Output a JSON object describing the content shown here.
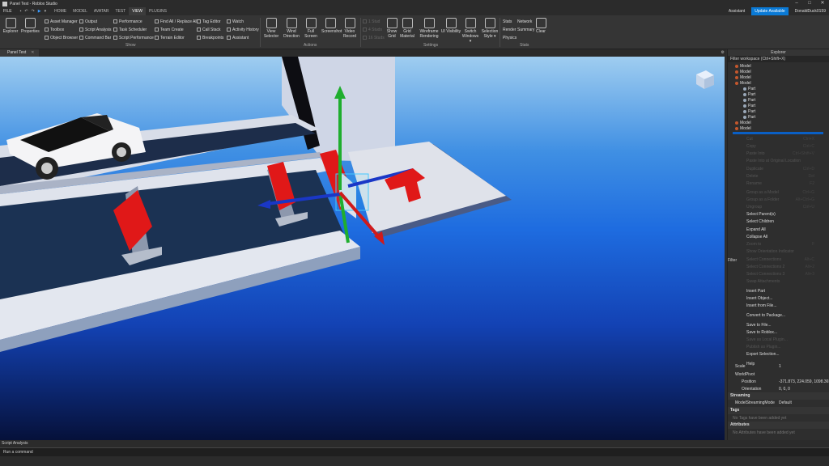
{
  "titlebar": {
    "title": "Panel Test - Roblox Studio",
    "min": "–",
    "max": "□",
    "close": "✕"
  },
  "menubar": {
    "file": "FILE",
    "tabs": [
      "HOME",
      "MODEL",
      "AVATAR",
      "TEST",
      "VIEW",
      "PLUGINS"
    ],
    "active_tab": "VIEW",
    "assistant": "Assistant",
    "update": "Update Available",
    "user": "DonaldDuck0159"
  },
  "ribbon": {
    "big_left": [
      "Explorer",
      "Properties"
    ],
    "show_col1": [
      "Asset Manager",
      "Toolbox",
      "Object Browser"
    ],
    "show_col2": [
      "Output",
      "Script Analysis",
      "Command Bar"
    ],
    "show_col3": [
      "Performance",
      "Task Scheduler",
      "Script Performance"
    ],
    "show_col4": [
      "Find All / Replace All",
      "Team Create",
      "Terrain Editor"
    ],
    "show_col5": [
      "Tag Editor",
      "Call Stack",
      "Breakpoints"
    ],
    "show_col6": [
      "Watch",
      "Activity History",
      "Assistant"
    ],
    "group_show": "Show",
    "actions": [
      {
        "l1": "View",
        "l2": "Selector"
      },
      {
        "l1": "Wind",
        "l2": "Direction"
      },
      {
        "l1": "Full",
        "l2": "Screen"
      },
      {
        "l1": "Screenshot",
        "l2": ""
      },
      {
        "l1": "Video",
        "l2": "Record"
      }
    ],
    "group_actions": "Actions",
    "studs": [
      "1 Stud",
      "4 Studs",
      "16 Studs"
    ],
    "settings": [
      {
        "l1": "Show",
        "l2": "Grid"
      },
      {
        "l1": "Grid",
        "l2": "Material"
      },
      {
        "l1": "Wireframe",
        "l2": "Rendering"
      },
      {
        "l1": "UI Visibility",
        "l2": ""
      },
      {
        "l1": "Switch",
        "l2": "Windows ▾"
      },
      {
        "l1": "Selection",
        "l2": "Style ▾"
      }
    ],
    "group_settings": "Settings",
    "stats_col1": [
      "Stats",
      "Render",
      "Physics"
    ],
    "stats_col2": [
      "Network",
      "Summary"
    ],
    "clear": "Clear",
    "group_stats": "Stats"
  },
  "doctab": {
    "label": "Panel Test",
    "close": "✕"
  },
  "explorer": {
    "title": "Explorer",
    "filter": "Filter workspace (Ctrl+Shift+X)",
    "rows": [
      {
        "label": "Model",
        "indent": 0,
        "icon": "model"
      },
      {
        "label": "Model",
        "indent": 0,
        "icon": "model"
      },
      {
        "label": "Model",
        "indent": 0,
        "icon": "model"
      },
      {
        "label": "Model",
        "indent": 0,
        "icon": "model"
      },
      {
        "label": "Part",
        "indent": 1,
        "icon": "part"
      },
      {
        "label": "Part",
        "indent": 1,
        "icon": "part"
      },
      {
        "label": "Part",
        "indent": 1,
        "icon": "part"
      },
      {
        "label": "Part",
        "indent": 1,
        "icon": "part"
      },
      {
        "label": "Part",
        "indent": 1,
        "icon": "part"
      },
      {
        "label": "Part",
        "indent": 1,
        "icon": "part"
      },
      {
        "label": "Model",
        "indent": 0,
        "icon": "model"
      },
      {
        "label": "Model",
        "indent": 0,
        "icon": "model"
      }
    ],
    "filter_label": "Filter"
  },
  "context_menu": [
    {
      "label": "Cut",
      "shortcut": "Ctrl+X",
      "enabled": false
    },
    {
      "label": "Copy",
      "shortcut": "Ctrl+C",
      "enabled": false
    },
    {
      "label": "Paste Into",
      "shortcut": "Ctrl+Shift+V",
      "enabled": false
    },
    {
      "label": "Paste Into at Original Location",
      "shortcut": "",
      "enabled": false
    },
    {
      "label": "Duplicate",
      "shortcut": "Ctrl+D",
      "enabled": false
    },
    {
      "label": "Delete",
      "shortcut": "Del",
      "enabled": false
    },
    {
      "label": "Rename",
      "shortcut": "F2",
      "enabled": false
    },
    {
      "label": "Group as a Model",
      "shortcut": "Ctrl+G",
      "enabled": false
    },
    {
      "label": "Group as a Folder",
      "shortcut": "Alt+Ctrl+G",
      "enabled": false
    },
    {
      "label": "Ungroup",
      "shortcut": "Ctrl+U",
      "enabled": false
    },
    {
      "label": "Select Parent(s)",
      "shortcut": "",
      "enabled": true
    },
    {
      "label": "Select Children",
      "shortcut": "",
      "enabled": true
    },
    {
      "label": "Expand All",
      "shortcut": "",
      "enabled": true
    },
    {
      "label": "Collapse All",
      "shortcut": "",
      "enabled": true
    },
    {
      "label": "Zoom to",
      "shortcut": "F",
      "enabled": false
    },
    {
      "label": "Show Orientation Indicator",
      "shortcut": "",
      "enabled": false
    },
    {
      "label": "Select Connections",
      "shortcut": "Alt+C",
      "enabled": false
    },
    {
      "label": "Select Connections 2",
      "shortcut": "Alt+2",
      "enabled": false
    },
    {
      "label": "Select Connections 3",
      "shortcut": "Alt+3",
      "enabled": false
    },
    {
      "label": "Swap Attachments",
      "shortcut": "",
      "enabled": false
    },
    {
      "label": "Insert Part",
      "shortcut": "",
      "enabled": true
    },
    {
      "label": "Insert Object...",
      "shortcut": "",
      "enabled": true
    },
    {
      "label": "Insert from File...",
      "shortcut": "",
      "enabled": true
    },
    {
      "label": "Convert to Package...",
      "shortcut": "",
      "enabled": true
    },
    {
      "label": "Save to File...",
      "shortcut": "",
      "enabled": true
    },
    {
      "label": "Save to Roblox...",
      "shortcut": "",
      "enabled": true
    },
    {
      "label": "Save as Local Plugin...",
      "shortcut": "",
      "enabled": false
    },
    {
      "label": "Publish as Plugin...",
      "shortcut": "",
      "enabled": false
    },
    {
      "label": "Export Selection...",
      "shortcut": "",
      "enabled": true
    },
    {
      "label": "Help",
      "shortcut": "",
      "enabled": true
    }
  ],
  "properties": {
    "scale_label": "Scale",
    "scale_value": "1",
    "worldpivot_label": "WorldPivot",
    "position_label": "Position",
    "position_value": "-371.873, 224.059, 1098.365",
    "orientation_label": "Orientation",
    "orientation_value": "0, 0, 0",
    "streaming_section": "Streaming",
    "streaming_mode_label": "ModelStreamingMode",
    "streaming_mode_value": "Default",
    "tags_section": "Tags",
    "tags_empty": "No Tags have been added yet",
    "attributes_section": "Attributes",
    "attributes_empty": "No Attributes have been added yet"
  },
  "statusbar": {
    "label": "Script Analysis"
  },
  "commandbar": {
    "placeholder": "Run a command"
  }
}
